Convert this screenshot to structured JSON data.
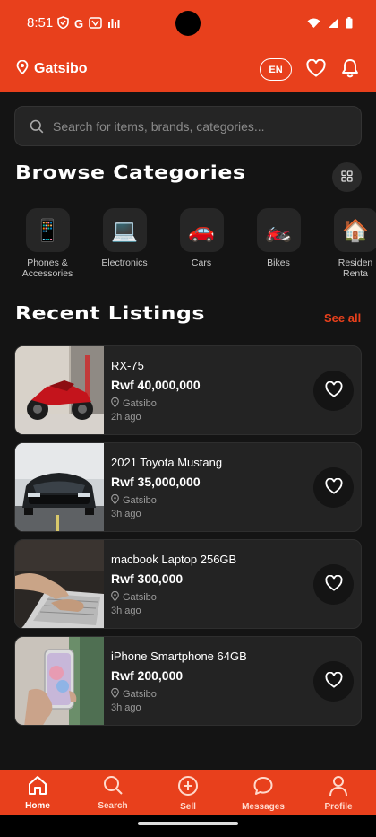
{
  "status_bar": {
    "time": "8:51",
    "icons": [
      "shield-icon",
      "google-g-icon",
      "vpn-icon",
      "bars-app-icon",
      "wifi-icon",
      "signal-icon",
      "battery-icon"
    ],
    "g_letter": "G"
  },
  "app_bar": {
    "location": "Gatsibo",
    "language": "EN"
  },
  "search": {
    "placeholder": "Search for items, brands, categories..."
  },
  "categories_section": {
    "title": "Browse Categories",
    "items": [
      {
        "label": "Phones & Accessories",
        "label_line1": "Phones &",
        "label_line2": "Accessories",
        "icon": "phone-icon",
        "glyph": "📱"
      },
      {
        "label": "Electronics",
        "label_line1": "Electronics",
        "label_line2": "",
        "icon": "laptop-icon",
        "glyph": "💻"
      },
      {
        "label": "Cars",
        "label_line1": "Cars",
        "label_line2": "",
        "icon": "car-icon",
        "glyph": "🚗"
      },
      {
        "label": "Bikes",
        "label_line1": "Bikes",
        "label_line2": "",
        "icon": "motorbike-icon",
        "glyph": "🏍️"
      },
      {
        "label": "Residential Rentals",
        "label_line1": "Residen",
        "label_line2": "Renta",
        "icon": "house-icon",
        "glyph": "🏠"
      }
    ]
  },
  "listings_section": {
    "title": "Recent Listings",
    "see_all": "See all",
    "items": [
      {
        "title": "RX-75",
        "price": "Rwf 40,000,000",
        "location": "Gatsibo",
        "ago": "2h ago",
        "image": "red-motorbike"
      },
      {
        "title": "2021 Toyota Mustang",
        "price": "Rwf 35,000,000",
        "location": "Gatsibo",
        "ago": "3h ago",
        "image": "black-mustang"
      },
      {
        "title": "macbook Laptop 256GB",
        "price": "Rwf 300,000",
        "location": "Gatsibo",
        "ago": "3h ago",
        "image": "hands-on-laptop"
      },
      {
        "title": "iPhone Smartphone 64GB",
        "price": "Rwf 200,000",
        "location": "Gatsibo",
        "ago": "3h ago",
        "image": "hand-holding-iphone"
      }
    ]
  },
  "bottom_nav": {
    "items": [
      {
        "label": "Home",
        "icon": "home-icon",
        "active": true
      },
      {
        "label": "Search",
        "icon": "search-icon",
        "active": false
      },
      {
        "label": "Sell",
        "icon": "plus-circle-icon",
        "active": false
      },
      {
        "label": "Messages",
        "icon": "chat-icon",
        "active": false
      },
      {
        "label": "Profile",
        "icon": "person-icon",
        "active": false
      }
    ]
  },
  "colors": {
    "accent": "#e8401c",
    "background": "#141414",
    "card": "#232323"
  }
}
